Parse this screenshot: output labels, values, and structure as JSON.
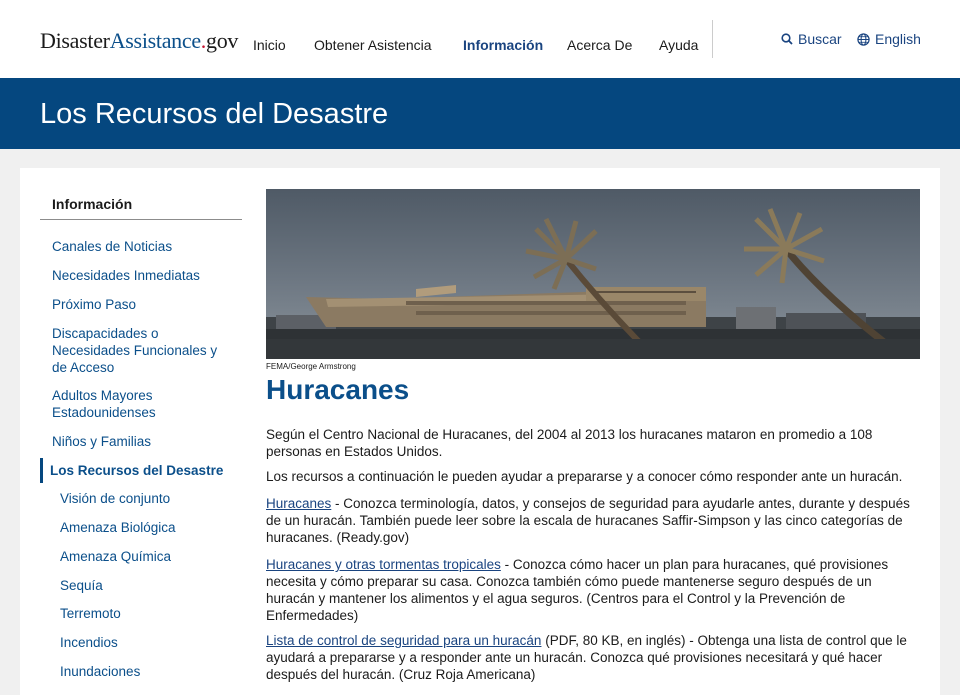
{
  "header": {
    "logo": {
      "part1": "Disaster",
      "part2": "Assistance",
      "dot": ".",
      "part3": "gov"
    },
    "nav": [
      "Inicio",
      "Obtener Asistencia",
      "Información",
      "Acerca De",
      "Ayuda"
    ],
    "search_label": "Buscar",
    "language_label": "English"
  },
  "banner": {
    "title": "Los Recursos del Desastre"
  },
  "sidebar": {
    "heading": "Información",
    "items": [
      "Canales de Noticias",
      "Necesidades Inmediatas",
      "Próximo Paso",
      "Discapacidades o Necesidades Funcionales y de Acceso",
      "Adultos Mayores Estadounidenses",
      "Niños y Familias",
      "Los Recursos del Desastre"
    ],
    "subitems": [
      "Visión de conjunto",
      "Amenaza Biológica",
      "Amenaza Química",
      "Sequía",
      "Terremoto",
      "Incendios",
      "Inundaciones"
    ]
  },
  "main": {
    "image_credit": "FEMA/George Armstrong",
    "title": "Huracanes",
    "intro": "Según el Centro Nacional de Huracanes, del 2004 al 2013 los huracanes mataron en promedio a 108 personas en Estados Unidos.",
    "lead": "Los recursos a continuación le pueden ayudar a prepararse y a conocer cómo responder ante un huracán.",
    "resources": [
      {
        "link": "Huracanes",
        "text": " - Conozca terminología, datos, y consejos de seguridad para ayudarle antes, durante y después de un huracán. También puede leer sobre la escala de huracanes Saffir-Simpson y las cinco categorías de huracanes. (Ready.gov)"
      },
      {
        "link": "Huracanes y otras tormentas tropicales",
        "text": " - Conozca cómo hacer un plan para huracanes, qué provisiones necesita y cómo preparar su casa. Conozca también cómo puede mantenerse seguro después de un huracán y mantener los alimentos y el agua seguros. (Centros para el Control y la Prevención de Enfermedades)"
      },
      {
        "link": "Lista de control de seguridad para un huracán",
        "text": " (PDF, 80 KB, en inglés) - Obtenga una lista de control que le ayudará a prepararse y a responder ante un huracán. Conozca qué provisiones necesitará y qué hacer después del huracán. (Cruz Roja Americana)"
      }
    ]
  },
  "colors": {
    "banner": "#05477f",
    "link": "#0b4f8a",
    "logo_dot": "#c41230"
  }
}
